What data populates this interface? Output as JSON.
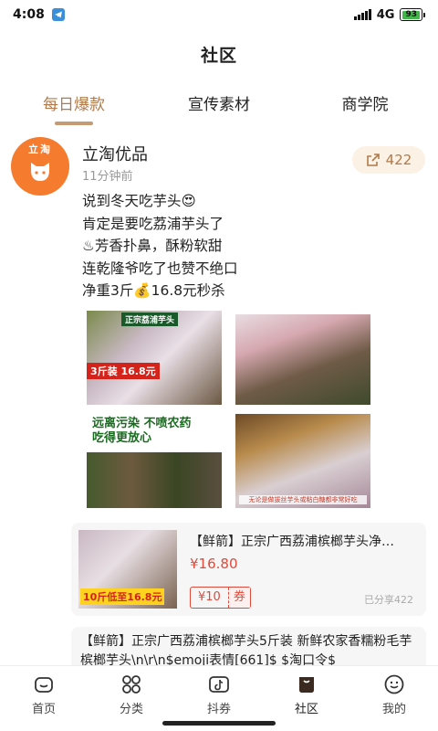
{
  "status_bar": {
    "time": "4:08",
    "network": "4G",
    "battery": "93"
  },
  "header": {
    "title": "社区"
  },
  "tabs": [
    {
      "label": "每日爆款",
      "active": true
    },
    {
      "label": "宣传素材",
      "active": false
    },
    {
      "label": "商学院",
      "active": false
    }
  ],
  "post": {
    "avatar_text": "立淘",
    "author": "立淘优品",
    "time": "11分钟前",
    "share_count": "422",
    "lines": [
      "说到冬天吃芋头😍",
      "肯定是要吃荔浦芋头了",
      "♨芳香扑鼻，酥粉软甜",
      "连乾隆爷吃了也赞不绝口",
      "净重3斤💰16.8元秒杀"
    ],
    "images": {
      "img1_badge": "正宗荔浦芋头",
      "img1_price": "3斤装 16.8元",
      "img3_title_1": "远离污染 不喷农药",
      "img3_title_2": "吃得更放心",
      "img4_caption": "无论是做拔丝芋头或粘白糖都非常好吃"
    }
  },
  "product": {
    "title": "【鲜箭】正宗广西荔浦槟榔芋头净…",
    "price": "¥16.80",
    "coupon_amount": "¥10",
    "coupon_label": "券",
    "shared": "已分享422",
    "thumb_price": "10斤低至16.8元"
  },
  "product2": {
    "text": "【鲜箭】正宗广西荔浦槟榔芋头5斤装 新鲜农家香糯粉毛芋槟榔芋头\\n\\r\\n$emoji表情[661]$ $淘口令$"
  },
  "bottom_nav": [
    {
      "label": "首页",
      "icon": "home-icon"
    },
    {
      "label": "分类",
      "icon": "grid-icon"
    },
    {
      "label": "抖券",
      "icon": "tiktok-icon"
    },
    {
      "label": "社区",
      "icon": "bag-icon",
      "active": true
    },
    {
      "label": "我的",
      "icon": "smile-icon"
    }
  ],
  "colors": {
    "accent": "#b07a4c",
    "avatar": "#f57b2e",
    "price_red": "#e04a3b"
  }
}
